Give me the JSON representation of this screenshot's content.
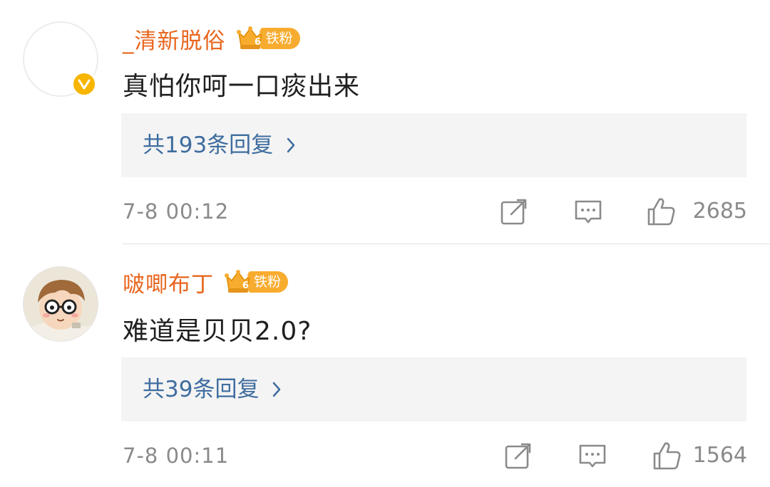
{
  "comments": [
    {
      "username": "_清新脱俗",
      "fan_badge": {
        "level": "6",
        "label": "铁粉"
      },
      "text": "真怕你呵一口痰出来",
      "replies_label": "共193条回复",
      "time": "7-8 00:12",
      "likes": "2685",
      "verified": true,
      "avatar": "blank-avatar"
    },
    {
      "username": "啵唧布丁",
      "fan_badge": {
        "level": "6",
        "label": "铁粉"
      },
      "text": "难道是贝贝2.0?",
      "replies_label": "共39条回复",
      "time": "7-8 00:11",
      "likes": "1564",
      "verified": false,
      "avatar": "cartoon-boy-glasses"
    }
  ],
  "colors": {
    "username": "#e8661e",
    "reply_link": "#3f6d9f",
    "badge": "#f8ac2f",
    "meta_gray": "#8a8a8a",
    "reply_bg": "#f4f4f4"
  },
  "icons": [
    "verified-v-icon",
    "crown-icon",
    "chevron-right-icon",
    "share-icon",
    "comment-icon",
    "like-thumb-icon"
  ]
}
